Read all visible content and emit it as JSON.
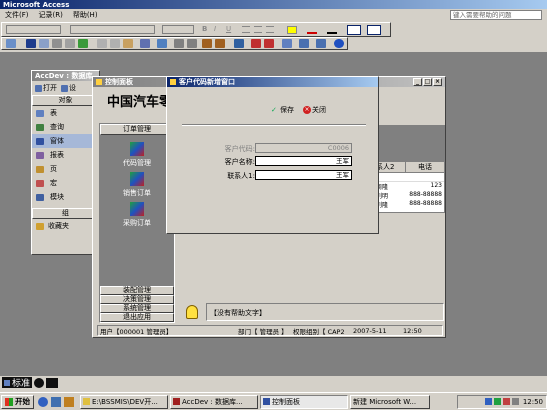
{
  "app": {
    "title": "Microsoft Access"
  },
  "menu": {
    "items": [
      "文件(F)",
      "记录(R)",
      "帮助(H)"
    ],
    "help_search_placeholder": "键入需要帮助的问题"
  },
  "db_window": {
    "title": "AccDev : 数据库",
    "open_label": "打开",
    "design_label": "设",
    "objects_header": "对象",
    "objects": [
      "表",
      "查询",
      "窗体",
      "报表",
      "页",
      "宏",
      "模块"
    ],
    "groups_header": "组",
    "favorites": "收藏夹"
  },
  "panel": {
    "title": "控制面板",
    "heading": "中国汽车零部",
    "section_order": "订单管理",
    "items": [
      "代码管理",
      "销售订单",
      "采购订单"
    ],
    "bottom_buttons": [
      "装配管理",
      "决策管理",
      "系统管理",
      "退出应用"
    ],
    "status_text": "【没有帮助文字】",
    "grid_headers": [
      "系人2",
      "电话"
    ],
    "grid_rows": [
      [
        "周隆",
        "123"
      ],
      [
        "刘明",
        "888-88888"
      ],
      [
        "刘隆",
        "888-88888"
      ]
    ],
    "footer": {
      "user": "用户【000001 管理员】",
      "dept": "部门【 管理员 】",
      "perm": "权限组别【 CAP2",
      "date": "2007-5-11",
      "time": "12:50"
    }
  },
  "dialog": {
    "title": "客户代码新增窗口",
    "save_label": "保存",
    "close_label": "关闭",
    "fields": [
      {
        "label": "客户代码:",
        "value": "C0006",
        "disabled": true
      },
      {
        "label": "客户名称:",
        "value": "王军",
        "disabled": false
      },
      {
        "label": "联系人1:",
        "value": "王军",
        "disabled": false
      }
    ]
  },
  "statusbar": {
    "mode": "标准"
  },
  "taskbar": {
    "start": "开始",
    "tasks": [
      "E:\\BSSMIS\\DEV开...",
      "AccDev : 数据库...",
      "控制面板",
      "新建 Microsoft W..."
    ],
    "clock": "12:50"
  },
  "colors": {
    "titlebar": "#0a246a",
    "titlebar_grad": "#a6caf0",
    "desktop": "#3a6ea5"
  }
}
